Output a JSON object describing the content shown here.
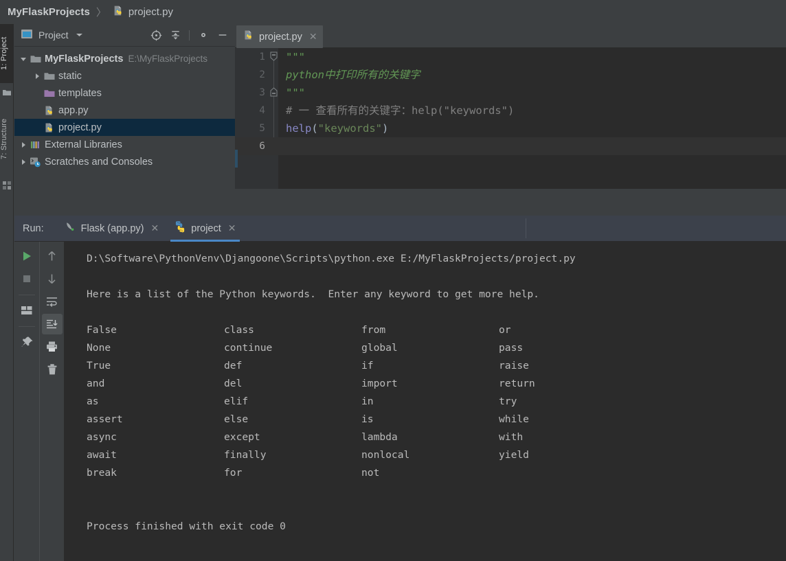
{
  "breadcrumb": {
    "root": "MyFlaskProjects",
    "separator": "〉",
    "leaf": "project.py",
    "leaf_icon": "python-file-icon"
  },
  "left_strip": {
    "tabs": [
      {
        "label": "1: Project",
        "active": true
      },
      {
        "label": "7: Structure",
        "active": false
      }
    ],
    "bottom_icon": "grid-icon"
  },
  "project_panel": {
    "icon": "project-view-icon",
    "title": "Project",
    "dropdown_icon": "chevron-down-icon",
    "toolbar": [
      {
        "name": "locate-icon",
        "title": "Select Opened File"
      },
      {
        "name": "collapse-all-icon",
        "title": "Collapse All"
      },
      {
        "name": "gear-icon",
        "title": "Settings"
      },
      {
        "name": "minimize-icon",
        "title": "Hide"
      }
    ],
    "tree": [
      {
        "label": "MyFlaskProjects",
        "path": "E:\\MyFlaskProjects",
        "icon": "folder-icon",
        "twist": "expanded",
        "indent": 0,
        "bold": true,
        "selected": false
      },
      {
        "label": "static",
        "path": "",
        "icon": "folder-icon",
        "twist": "collapsed",
        "indent": 1,
        "bold": false,
        "selected": false
      },
      {
        "label": "templates",
        "path": "",
        "icon": "folder-templates-icon",
        "twist": "none",
        "indent": 1,
        "bold": false,
        "selected": false
      },
      {
        "label": "app.py",
        "path": "",
        "icon": "python-file-icon",
        "twist": "none",
        "indent": 1,
        "bold": false,
        "selected": false
      },
      {
        "label": "project.py",
        "path": "",
        "icon": "python-file-icon",
        "twist": "none",
        "indent": 1,
        "bold": false,
        "selected": true
      },
      {
        "label": "External Libraries",
        "path": "",
        "icon": "libraries-icon",
        "twist": "collapsed",
        "indent": 0,
        "bold": false,
        "selected": false
      },
      {
        "label": "Scratches and Consoles",
        "path": "",
        "icon": "scratches-icon",
        "twist": "collapsed",
        "indent": 0,
        "bold": false,
        "selected": false
      }
    ]
  },
  "editor": {
    "tab": {
      "label": "project.py",
      "icon": "python-file-icon",
      "close_icon": "close-icon"
    },
    "lines": [
      {
        "num": "1",
        "fold": "fold-start",
        "current": false,
        "tokens": [
          {
            "cls": "c-doc",
            "text": "\"\"\""
          }
        ]
      },
      {
        "num": "2",
        "fold": "none",
        "current": false,
        "tokens": [
          {
            "cls": "c-doc",
            "text": "python中打印所有的关键字"
          }
        ]
      },
      {
        "num": "3",
        "fold": "fold-end",
        "current": false,
        "tokens": [
          {
            "cls": "c-doc",
            "text": "\"\"\""
          }
        ]
      },
      {
        "num": "4",
        "fold": "none",
        "current": false,
        "tokens": [
          {
            "cls": "c-cmt",
            "text": "# 一 查看所有的关键字：help(\"keywords\")"
          }
        ]
      },
      {
        "num": "5",
        "fold": "none",
        "current": false,
        "tokens": [
          {
            "cls": "c-kw",
            "text": "help"
          },
          {
            "cls": "c-pn",
            "text": "("
          },
          {
            "cls": "c-str",
            "text": "\"keywords\""
          },
          {
            "cls": "c-pn",
            "text": ")"
          }
        ]
      },
      {
        "num": "6",
        "fold": "none",
        "current": true,
        "tokens": [
          {
            "cls": "c-pn",
            "text": ""
          }
        ]
      }
    ]
  },
  "run_panel": {
    "label": "Run:",
    "tabs": [
      {
        "label": "Flask (app.py)",
        "icon": "flask-icon",
        "close_icon": "close-icon",
        "active": false
      },
      {
        "label": "project",
        "icon": "python-icon",
        "close_icon": "close-icon",
        "active": true
      }
    ],
    "toolbar_left": [
      {
        "name": "run-icon",
        "selected": false
      },
      {
        "name": "stop-icon",
        "selected": false
      },
      {
        "name": "separator",
        "selected": false
      },
      {
        "name": "layout-icon",
        "selected": false
      },
      {
        "name": "separator",
        "selected": false
      },
      {
        "name": "pin-icon",
        "selected": false
      }
    ],
    "toolbar_right": [
      {
        "name": "up-arrow-icon",
        "selected": false
      },
      {
        "name": "down-arrow-icon",
        "selected": false
      },
      {
        "name": "soft-wrap-icon",
        "selected": false
      },
      {
        "name": "scroll-to-end-icon",
        "selected": true
      },
      {
        "name": "print-icon",
        "selected": false
      },
      {
        "name": "trash-icon",
        "selected": false
      }
    ],
    "console": {
      "command": "D:\\Software\\PythonVenv\\Djangoone\\Scripts\\python.exe E:/MyFlaskProjects/project.py",
      "intro": "Here is a list of the Python keywords.  Enter any keyword to get more help.",
      "keyword_columns": [
        [
          "False",
          "None",
          "True",
          "and",
          "as",
          "assert",
          "async",
          "await",
          "break"
        ],
        [
          "class",
          "continue",
          "def",
          "del",
          "elif",
          "else",
          "except",
          "finally",
          "for"
        ],
        [
          "from",
          "global",
          "if",
          "import",
          "in",
          "is",
          "lambda",
          "nonlocal",
          "not"
        ],
        [
          "or",
          "pass",
          "raise",
          "return",
          "try",
          "while",
          "with",
          "yield",
          ""
        ]
      ],
      "exit_message": "Process finished with exit code 0"
    }
  },
  "colors": {
    "panel_bg": "#3c3f41",
    "editor_bg": "#2b2b2b",
    "selection": "#0d293e",
    "accent": "#4a88c7",
    "run_tabbar": "#3c414b",
    "text": "#bdc1c4",
    "console_text": "#bbbbbb",
    "docstring_green": "#629755",
    "keyword_purple": "#8888c6",
    "string_green": "#6a8759",
    "comment_gray": "#808080"
  }
}
